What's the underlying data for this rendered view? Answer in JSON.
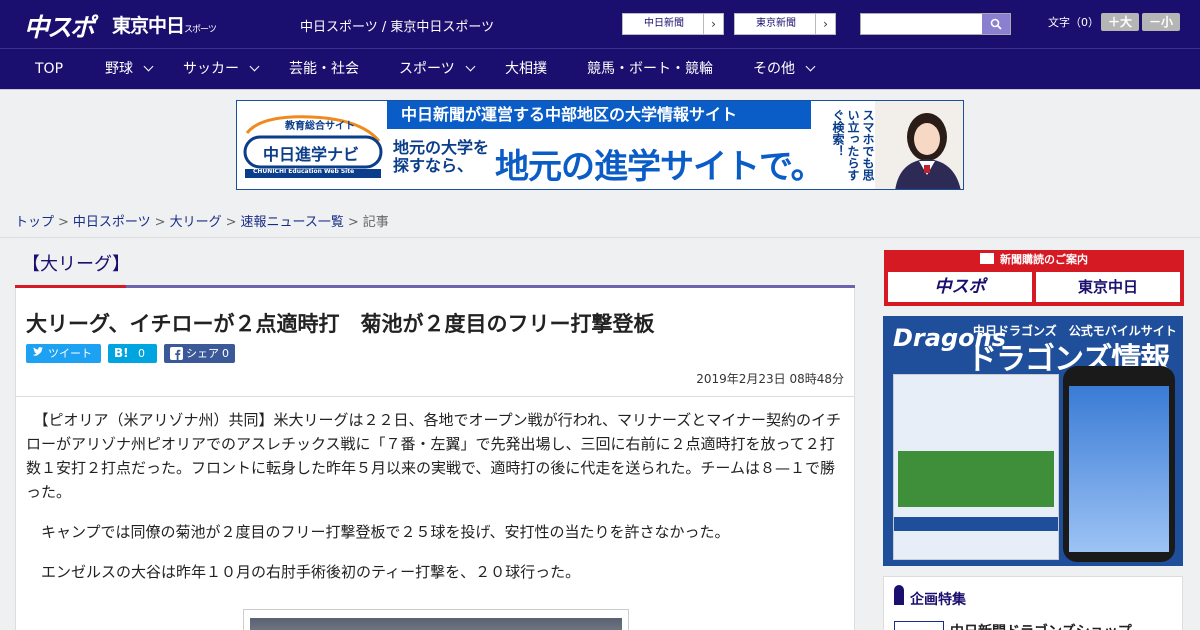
{
  "header": {
    "logo_main": "中スポ",
    "logo_sub": "東京中日",
    "logo_sub_small": "スポーツ",
    "site_name": "中日スポーツ / 東京中日スポーツ",
    "site_links": [
      "中日新聞",
      "東京新聞"
    ],
    "search_placeholder": "",
    "font_size_label": "文字（0）",
    "font_larger": "＋大",
    "font_smaller": "－小"
  },
  "nav": [
    {
      "label": "TOP",
      "has_menu": false
    },
    {
      "label": "野球",
      "has_menu": true
    },
    {
      "label": "サッカー",
      "has_menu": true
    },
    {
      "label": "芸能・社会",
      "has_menu": false
    },
    {
      "label": "スポーツ",
      "has_menu": true
    },
    {
      "label": "大相撲",
      "has_menu": false
    },
    {
      "label": "競馬・ボート・競輪",
      "has_menu": false
    },
    {
      "label": "その他",
      "has_menu": true
    }
  ],
  "banner": {
    "logo_top": "教育総合サイト",
    "logo_main": "中日進学ナビ",
    "logo_en": "CHUNICHI Education Web Site",
    "headline": "中日新聞が運営する中部地区の大学情報サイト",
    "sub": "地元の大学を探すなら、",
    "big": "地元の進学サイトで。",
    "vertical": "スマホでも思い立ったらすぐ検索！"
  },
  "breadcrumb": [
    {
      "label": "トップ",
      "link": true
    },
    {
      "label": "中日スポーツ",
      "link": true
    },
    {
      "label": "大リーグ",
      "link": true
    },
    {
      "label": "速報ニュース一覧",
      "link": true
    },
    {
      "label": "記事",
      "link": false
    }
  ],
  "article": {
    "category": "【大リーグ】",
    "title": "大リーグ、イチローが２点適時打　菊池が２度目のフリー打撃登板",
    "share": {
      "tweet": "ツイート",
      "hatena_count": "0",
      "facebook": "シェア",
      "facebook_count": "0"
    },
    "date": "2019年2月23日 08時48分",
    "paragraphs": [
      "　【ピオリア（米アリゾナ州）共同】米大リーグは２２日、各地でオープン戦が行われ、マリナーズとマイナー契約のイチローがアリゾナ州ピオリアでのアスレチックス戦に「７番・左翼」で先発出場し、三回に右前に２点適時打を放って２打数１安打２打点だった。フロントに転身した昨年５月以来の実戦で、適時打の後に代走を送られた。チームは８—１で勝った。",
      "　キャンプでは同僚の菊池が２度目のフリー打撃登板で２５球を投げ、安打性の当たりを許さなかった。",
      "　エンゼルスの大谷は昨年１０月の右肘手術後初のティー打撃を、２０球行った。"
    ]
  },
  "sidebar": {
    "subscribe_head": "新聞購読のご案内",
    "subscribe_links": [
      "中スポ",
      "東京中日"
    ],
    "dragons_brand": "Dragons",
    "dragons_small": "中日ドラゴンズ　公式モバイルサイト",
    "dragons_big": "ドラゴンズ情報",
    "feature_title": "企画特集",
    "feature_item": "中日新聞ドラゴンズショップ"
  },
  "colors": {
    "header_bg": "#1a0f6e",
    "accent_red": "#d71a25",
    "link": "#1a2d86"
  }
}
